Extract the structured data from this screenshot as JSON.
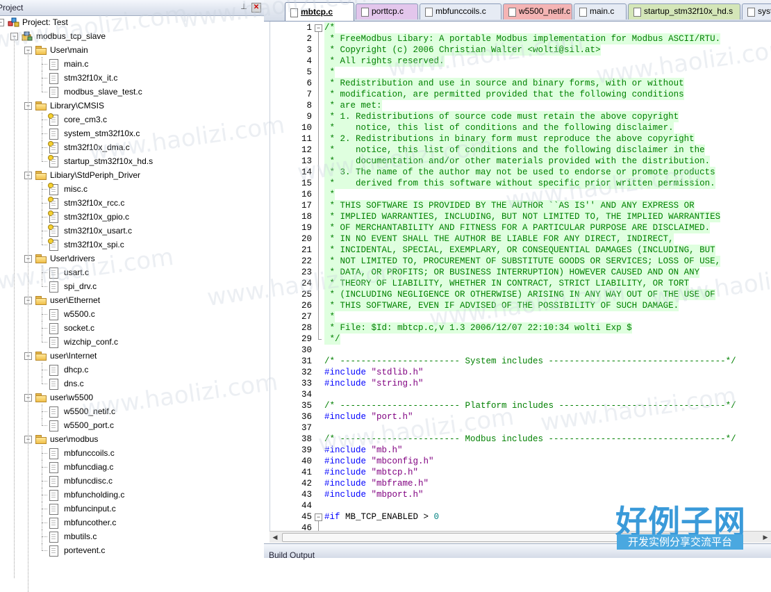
{
  "project_panel": {
    "title": "Project",
    "pin_icon": "pin-icon",
    "close_icon": "close-icon",
    "tree": [
      {
        "label": "Project: Test",
        "type": "project"
      },
      {
        "label": "modbus_tcp_slave",
        "type": "target"
      },
      {
        "label": "User\\main",
        "type": "folder"
      },
      {
        "label": "main.c",
        "type": "file"
      },
      {
        "label": "stm32f10x_it.c",
        "type": "file"
      },
      {
        "label": "modbus_slave_test.c",
        "type": "file"
      },
      {
        "label": "Library\\CMSIS",
        "type": "folder"
      },
      {
        "label": "core_cm3.c",
        "type": "file-key"
      },
      {
        "label": "system_stm32f10x.c",
        "type": "file"
      },
      {
        "label": "stm32f10x_dma.c",
        "type": "file-key"
      },
      {
        "label": "startup_stm32f10x_hd.s",
        "type": "file-key"
      },
      {
        "label": "Libiary\\StdPeriph_Driver",
        "type": "folder"
      },
      {
        "label": "misc.c",
        "type": "file-key"
      },
      {
        "label": "stm32f10x_rcc.c",
        "type": "file-key"
      },
      {
        "label": "stm32f10x_gpio.c",
        "type": "file-key"
      },
      {
        "label": "stm32f10x_usart.c",
        "type": "file-key"
      },
      {
        "label": "stm32f10x_spi.c",
        "type": "file-key"
      },
      {
        "label": "User\\drivers",
        "type": "folder"
      },
      {
        "label": "usart.c",
        "type": "file"
      },
      {
        "label": "spi_drv.c",
        "type": "file"
      },
      {
        "label": "user\\Ethernet",
        "type": "folder"
      },
      {
        "label": "w5500.c",
        "type": "file"
      },
      {
        "label": "socket.c",
        "type": "file"
      },
      {
        "label": "wizchip_conf.c",
        "type": "file"
      },
      {
        "label": "user\\Internet",
        "type": "folder"
      },
      {
        "label": "dhcp.c",
        "type": "file"
      },
      {
        "label": "dns.c",
        "type": "file"
      },
      {
        "label": "user\\w5500",
        "type": "folder"
      },
      {
        "label": "w5500_netif.c",
        "type": "file"
      },
      {
        "label": "w5500_port.c",
        "type": "file"
      },
      {
        "label": "user\\modbus",
        "type": "folder"
      },
      {
        "label": "mbfunccoils.c",
        "type": "file"
      },
      {
        "label": "mbfuncdiag.c",
        "type": "file"
      },
      {
        "label": "mbfuncdisc.c",
        "type": "file"
      },
      {
        "label": "mbfuncholding.c",
        "type": "file"
      },
      {
        "label": "mbfuncinput.c",
        "type": "file"
      },
      {
        "label": "mbfuncother.c",
        "type": "file"
      },
      {
        "label": "mbutils.c",
        "type": "file"
      },
      {
        "label": "portevent.c",
        "type": "file"
      }
    ]
  },
  "editor": {
    "tabs": [
      {
        "label": "mbtcp.c",
        "color": "#ffffff",
        "active": true
      },
      {
        "label": "porttcp.c",
        "color": "#e3c6ec"
      },
      {
        "label": "mbfunccoils.c",
        "color": "#e6ebf4"
      },
      {
        "label": "w5500_netif.c",
        "color": "#f4b4b4"
      },
      {
        "label": "main.c",
        "color": "#e6ebf4"
      },
      {
        "label": "startup_stm32f10x_hd.s",
        "color": "#d4e6b8"
      },
      {
        "label": "system_",
        "color": "#e6ebf4"
      }
    ],
    "lines": [
      {
        "n": "1",
        "t": "/*",
        "k": "comment"
      },
      {
        "n": "2",
        "t": " * FreeModbus Libary: A portable Modbus implementation for Modbus ASCII/RTU.",
        "k": "comment"
      },
      {
        "n": "3",
        "t": " * Copyright (c) 2006 Christian Walter <wolti@sil.at>",
        "k": "comment"
      },
      {
        "n": "4",
        "t": " * All rights reserved.",
        "k": "comment"
      },
      {
        "n": "5",
        "t": " *",
        "k": "comment"
      },
      {
        "n": "6",
        "t": " * Redistribution and use in source and binary forms, with or without",
        "k": "comment"
      },
      {
        "n": "7",
        "t": " * modification, are permitted provided that the following conditions",
        "k": "comment"
      },
      {
        "n": "8",
        "t": " * are met:",
        "k": "comment"
      },
      {
        "n": "9",
        "t": " * 1. Redistributions of source code must retain the above copyright",
        "k": "comment"
      },
      {
        "n": "10",
        "t": " *    notice, this list of conditions and the following disclaimer.",
        "k": "comment"
      },
      {
        "n": "11",
        "t": " * 2. Redistributions in binary form must reproduce the above copyright",
        "k": "comment"
      },
      {
        "n": "12",
        "t": " *    notice, this list of conditions and the following disclaimer in the",
        "k": "comment"
      },
      {
        "n": "13",
        "t": " *    documentation and/or other materials provided with the distribution.",
        "k": "comment"
      },
      {
        "n": "14",
        "t": " * 3. The name of the author may not be used to endorse or promote products",
        "k": "comment"
      },
      {
        "n": "15",
        "t": " *    derived from this software without specific prior written permission.",
        "k": "comment"
      },
      {
        "n": "16",
        "t": " *",
        "k": "comment"
      },
      {
        "n": "17",
        "t": " * THIS SOFTWARE IS PROVIDED BY THE AUTHOR ``AS IS'' AND ANY EXPRESS OR",
        "k": "comment"
      },
      {
        "n": "18",
        "t": " * IMPLIED WARRANTIES, INCLUDING, BUT NOT LIMITED TO, THE IMPLIED WARRANTIES",
        "k": "comment"
      },
      {
        "n": "19",
        "t": " * OF MERCHANTABILITY AND FITNESS FOR A PARTICULAR PURPOSE ARE DISCLAIMED.",
        "k": "comment"
      },
      {
        "n": "20",
        "t": " * IN NO EVENT SHALL THE AUTHOR BE LIABLE FOR ANY DIRECT, INDIRECT,",
        "k": "comment"
      },
      {
        "n": "21",
        "t": " * INCIDENTAL, SPECIAL, EXEMPLARY, OR CONSEQUENTIAL DAMAGES (INCLUDING, BUT",
        "k": "comment"
      },
      {
        "n": "22",
        "t": " * NOT LIMITED TO, PROCUREMENT OF SUBSTITUTE GOODS OR SERVICES; LOSS OF USE,",
        "k": "comment"
      },
      {
        "n": "23",
        "t": " * DATA, OR PROFITS; OR BUSINESS INTERRUPTION) HOWEVER CAUSED AND ON ANY",
        "k": "comment"
      },
      {
        "n": "24",
        "t": " * THEORY OF LIABILITY, WHETHER IN CONTRACT, STRICT LIABILITY, OR TORT",
        "k": "comment"
      },
      {
        "n": "25",
        "t": " * (INCLUDING NEGLIGENCE OR OTHERWISE) ARISING IN ANY WAY OUT OF THE USE OF",
        "k": "comment"
      },
      {
        "n": "26",
        "t": " * THIS SOFTWARE, EVEN IF ADVISED OF THE POSSIBILITY OF SUCH DAMAGE.",
        "k": "comment"
      },
      {
        "n": "27",
        "t": " *",
        "k": "comment"
      },
      {
        "n": "28",
        "t": " * File: $Id: mbtcp.c,v 1.3 2006/12/07 22:10:34 wolti Exp $",
        "k": "comment"
      },
      {
        "n": "29",
        "t": " */",
        "k": "comment"
      },
      {
        "n": "30",
        "t": "",
        "k": "plain"
      },
      {
        "n": "31",
        "t": "/* ----------------------- System includes ----------------------------------*/",
        "k": "comment"
      },
      {
        "n": "32",
        "pp": "#include",
        "str": " \"stdlib.h\"",
        "k": "include"
      },
      {
        "n": "33",
        "pp": "#include",
        "str": " \"string.h\"",
        "k": "include"
      },
      {
        "n": "34",
        "t": "",
        "k": "plain"
      },
      {
        "n": "35",
        "t": "/* ----------------------- Platform includes --------------------------------*/",
        "k": "comment"
      },
      {
        "n": "36",
        "pp": "#include",
        "str": " \"port.h\"",
        "k": "include"
      },
      {
        "n": "37",
        "t": "",
        "k": "plain"
      },
      {
        "n": "38",
        "t": "/* ----------------------- Modbus includes ----------------------------------*/",
        "k": "comment"
      },
      {
        "n": "39",
        "pp": "#include",
        "str": " \"mb.h\"",
        "k": "include"
      },
      {
        "n": "40",
        "pp": "#include",
        "str": " \"mbconfig.h\"",
        "k": "include"
      },
      {
        "n": "41",
        "pp": "#include",
        "str": " \"mbtcp.h\"",
        "k": "include"
      },
      {
        "n": "42",
        "pp": "#include",
        "str": " \"mbframe.h\"",
        "k": "include"
      },
      {
        "n": "43",
        "pp": "#include",
        "str": " \"mbport.h\"",
        "k": "include"
      },
      {
        "n": "44",
        "t": "",
        "k": "plain"
      },
      {
        "n": "45",
        "pp": "#if",
        "plain": " MB_TCP_ENABLED > ",
        "num": "0",
        "k": "if"
      },
      {
        "n": "46",
        "t": "",
        "k": "plain"
      }
    ]
  },
  "bottom_panel": {
    "label": "Build Output"
  },
  "watermark": {
    "text": "www.haolizi.com"
  },
  "brand": {
    "title": "好例子网",
    "subtitle": "开发实例分享交流平台"
  }
}
